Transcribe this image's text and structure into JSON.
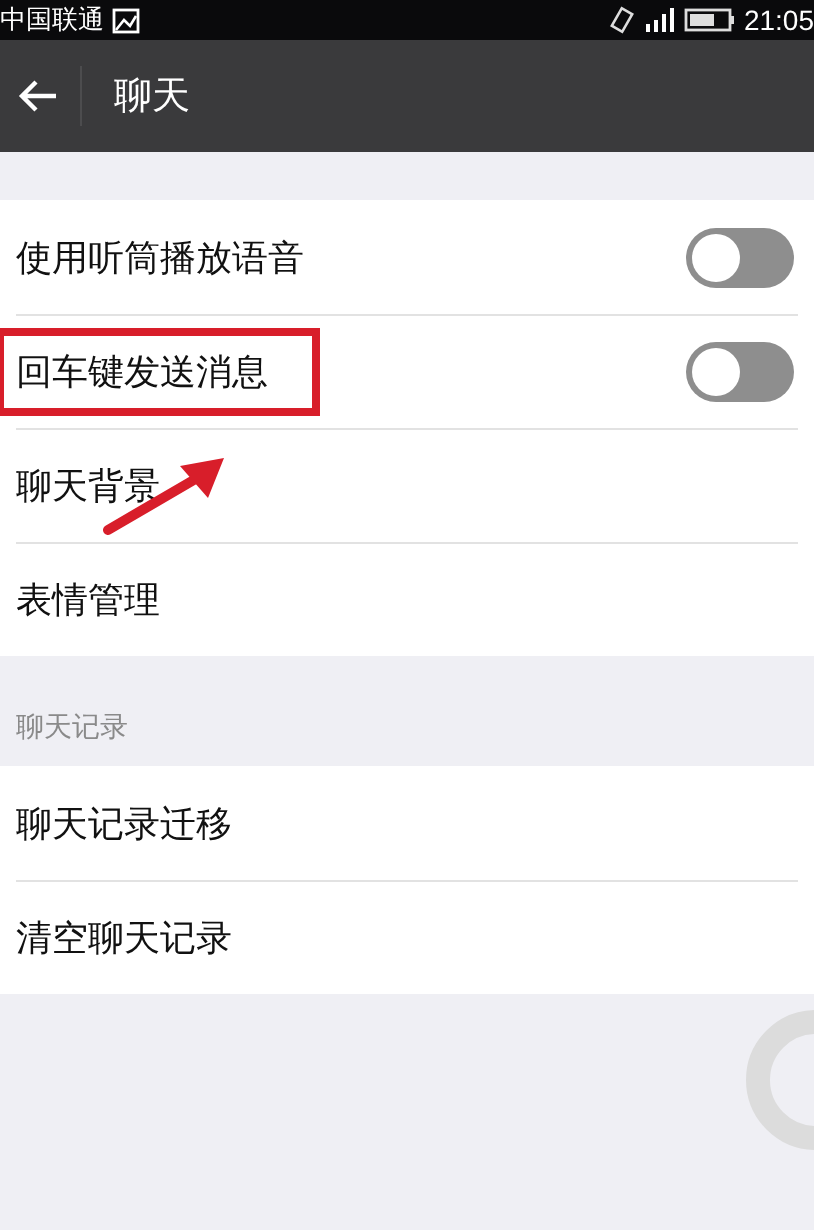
{
  "status_bar": {
    "carrier": "中国联通",
    "time": "21:05"
  },
  "title_bar": {
    "title": "聊天"
  },
  "sections": [
    {
      "items": [
        {
          "label": "使用听筒播放语音",
          "kind": "toggle",
          "on": false,
          "annotated": false
        },
        {
          "label": "回车键发送消息",
          "kind": "toggle",
          "on": false,
          "annotated": true
        },
        {
          "label": "聊天背景",
          "kind": "link",
          "annotated": false
        },
        {
          "label": "表情管理",
          "kind": "link",
          "annotated": false
        }
      ]
    },
    {
      "header": "聊天记录",
      "items": [
        {
          "label": "聊天记录迁移",
          "kind": "link",
          "annotated": false
        },
        {
          "label": "清空聊天记录",
          "kind": "link",
          "annotated": false
        }
      ]
    }
  ]
}
